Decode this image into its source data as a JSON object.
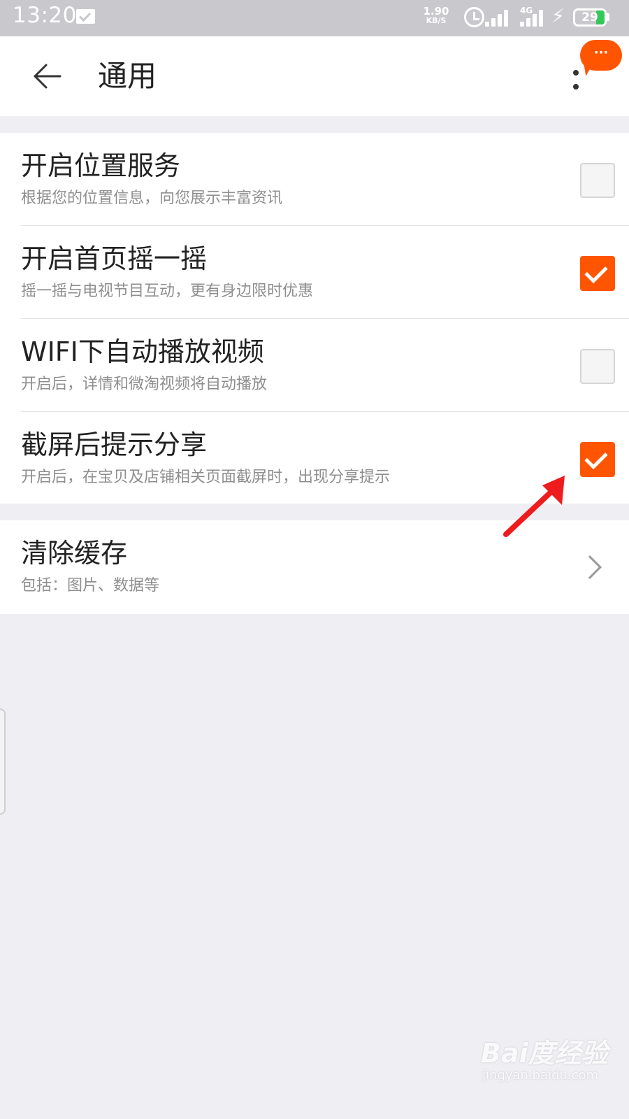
{
  "status_bar": {
    "time": "13:20",
    "net_speed_value": "1.90",
    "net_speed_unit": "KB/S",
    "network_type": "4G",
    "battery_level": "29",
    "icons": [
      "message-icon",
      "alarm-icon",
      "signal-icon",
      "charging-icon",
      "battery-icon"
    ]
  },
  "header": {
    "title": "通用",
    "back_icon": "arrow-left-icon",
    "more_icon": "more-vertical-icon",
    "bubble_text": "···"
  },
  "settings": {
    "items": [
      {
        "title": "开启位置服务",
        "subtitle": "根据您的位置信息，向您展示丰富资讯",
        "checked": false
      },
      {
        "title": "开启首页摇一摇",
        "subtitle": "摇一摇与电视节目互动，更有身边限时优惠",
        "checked": true
      },
      {
        "title": "WIFI下自动播放视频",
        "subtitle": "开启后，详情和微淘视频将自动播放",
        "checked": false
      },
      {
        "title": "截屏后提示分享",
        "subtitle": "开启后，在宝贝及店铺相关页面截屏时，出现分享提示",
        "checked": true
      }
    ],
    "cache": {
      "title": "清除缓存",
      "subtitle": "包括：图片、数据等"
    }
  },
  "watermark": {
    "logo": "Bai度经验",
    "url": "jingyan.baidu.com"
  },
  "colors": {
    "accent": "#ff5500",
    "background": "#efeef2",
    "status_bar": "#c9c8cc"
  }
}
